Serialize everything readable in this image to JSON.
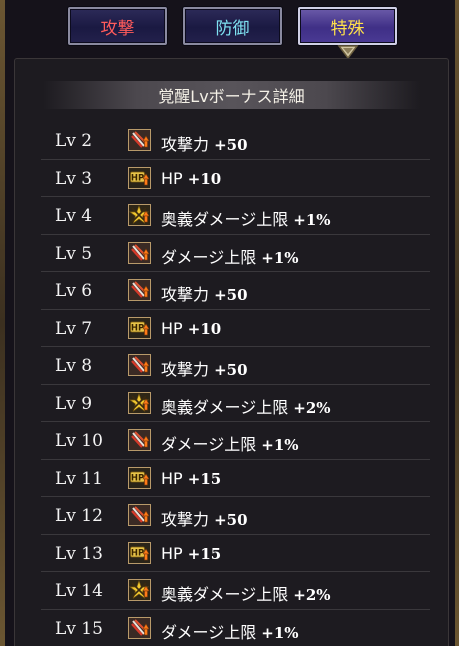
{
  "tabs": [
    {
      "label": "攻撃",
      "color": "#ff5b5b",
      "active": false
    },
    {
      "label": "防御",
      "color": "#7fe3f2",
      "active": false
    },
    {
      "label": "特殊",
      "color": "#ffe14a",
      "active": true
    }
  ],
  "panel": {
    "title": "覚醒Lvボーナス詳細"
  },
  "rows": [
    {
      "level": "Lv 2",
      "icon": "attack-icon",
      "stat": "攻撃力",
      "value": "+50"
    },
    {
      "level": "Lv 3",
      "icon": "hp-icon",
      "stat": "HP",
      "value": "+10"
    },
    {
      "level": "Lv 4",
      "icon": "special-cap-icon",
      "stat": "奥義ダメージ上限",
      "value": "+1%"
    },
    {
      "level": "Lv 5",
      "icon": "attack-icon",
      "stat": "ダメージ上限",
      "value": "+1%"
    },
    {
      "level": "Lv 6",
      "icon": "attack-icon",
      "stat": "攻撃力",
      "value": "+50"
    },
    {
      "level": "Lv 7",
      "icon": "hp-icon",
      "stat": "HP",
      "value": "+10"
    },
    {
      "level": "Lv 8",
      "icon": "attack-icon",
      "stat": "攻撃力",
      "value": "+50"
    },
    {
      "level": "Lv 9",
      "icon": "special-cap-icon",
      "stat": "奥義ダメージ上限",
      "value": "+2%"
    },
    {
      "level": "Lv 10",
      "icon": "attack-icon",
      "stat": "ダメージ上限",
      "value": "+1%"
    },
    {
      "level": "Lv 11",
      "icon": "hp-icon",
      "stat": "HP",
      "value": "+15"
    },
    {
      "level": "Lv 12",
      "icon": "attack-icon",
      "stat": "攻撃力",
      "value": "+50"
    },
    {
      "level": "Lv 13",
      "icon": "hp-icon",
      "stat": "HP",
      "value": "+15"
    },
    {
      "level": "Lv 14",
      "icon": "special-cap-icon",
      "stat": "奥義ダメージ上限",
      "value": "+2%"
    },
    {
      "level": "Lv 15",
      "icon": "attack-icon",
      "stat": "ダメージ上限",
      "value": "+1%"
    }
  ]
}
